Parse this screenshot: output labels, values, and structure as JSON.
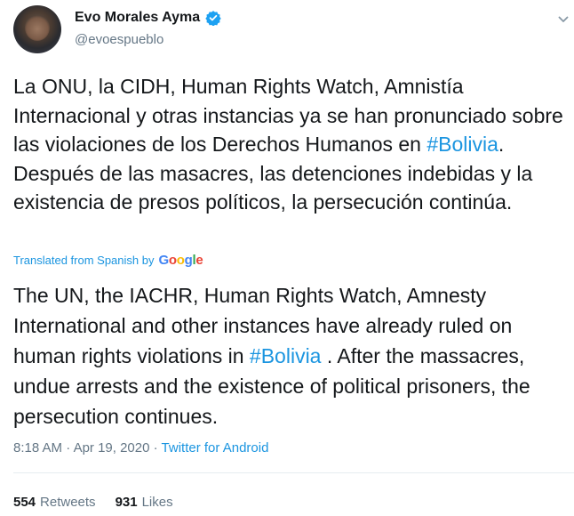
{
  "author": {
    "name": "Evo Morales Ayma",
    "handle": "@evoespueblo",
    "verified": true
  },
  "tweet": {
    "parts": [
      {
        "text": "La ONU, la CIDH, Human Rights Watch, Amnistía Internacional y otras instancias ya se han pronunciado sobre las violaciones de los Derechos Humanos en "
      },
      {
        "text": "#Bolivia",
        "hashtag": true
      },
      {
        "text": ". Después de las masacres, las detenciones indebidas y la existencia de presos políticos, la persecución continúa."
      }
    ]
  },
  "translation": {
    "label": "Translated from Spanish by",
    "provider": "Google",
    "parts": [
      {
        "text": "The UN, the IACHR, Human Rights Watch, Amnesty International and other instances have already ruled on human rights violations in "
      },
      {
        "text": "#Bolivia",
        "hashtag": true
      },
      {
        "text": " . After the massacres, undue arrests and the existence of political prisoners, the persecution continues."
      }
    ]
  },
  "meta": {
    "time": "8:18 AM",
    "separator": "·",
    "date": "Apr 19, 2020",
    "source": "Twitter for Android"
  },
  "stats": {
    "retweets_count": "554",
    "retweets_label": "Retweets",
    "likes_count": "931",
    "likes_label": "Likes"
  },
  "icons": {
    "verified": "verified-badge-icon",
    "menu": "chevron-down-icon"
  },
  "colors": {
    "link": "#1b95e0",
    "text": "#14171a",
    "secondary": "#657786",
    "verified": "#1da1f2"
  }
}
